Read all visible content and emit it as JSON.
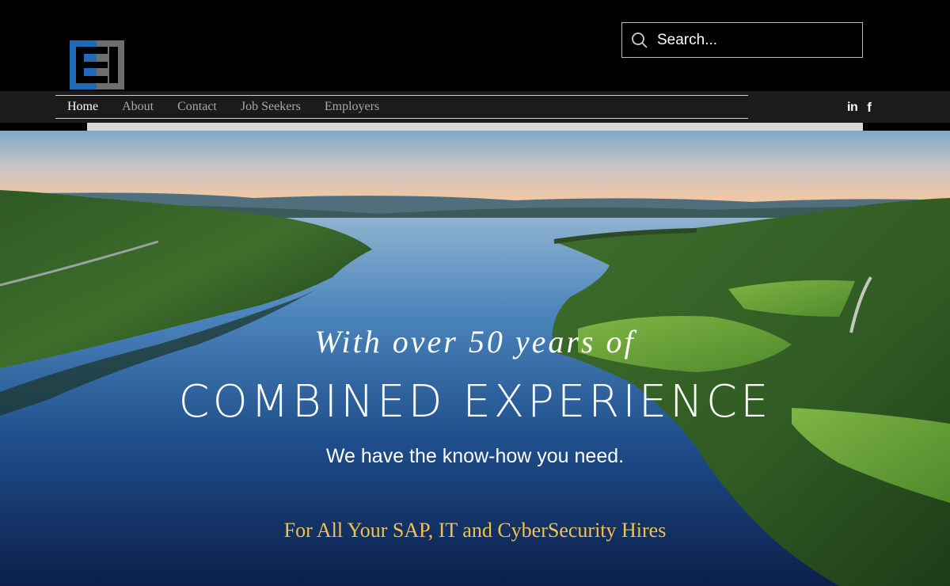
{
  "header": {
    "logo_icon": "letter-b-block-logo",
    "search": {
      "placeholder": "Search...",
      "icon": "search-icon"
    }
  },
  "nav": {
    "items": [
      {
        "label": "Home",
        "active": true
      },
      {
        "label": "About",
        "active": false
      },
      {
        "label": "Contact",
        "active": false
      },
      {
        "label": "Job Seekers",
        "active": false
      },
      {
        "label": "Employers",
        "active": false
      }
    ]
  },
  "social": {
    "linkedin_label": "in",
    "facebook_label": "f"
  },
  "hero": {
    "line1": "With over 50 years of",
    "line2": "COMBINED EXPERIENCE",
    "line3": "We have the know-how you need.",
    "line4": "For All Your SAP, IT and CyberSecurity Hires"
  },
  "colors": {
    "header_bg": "#000000",
    "nav_band": "#1b1b1b",
    "logo_blue": "#1f6bb5",
    "logo_grey": "#6e6e6e",
    "tagline_gold": "#f2c24a"
  }
}
